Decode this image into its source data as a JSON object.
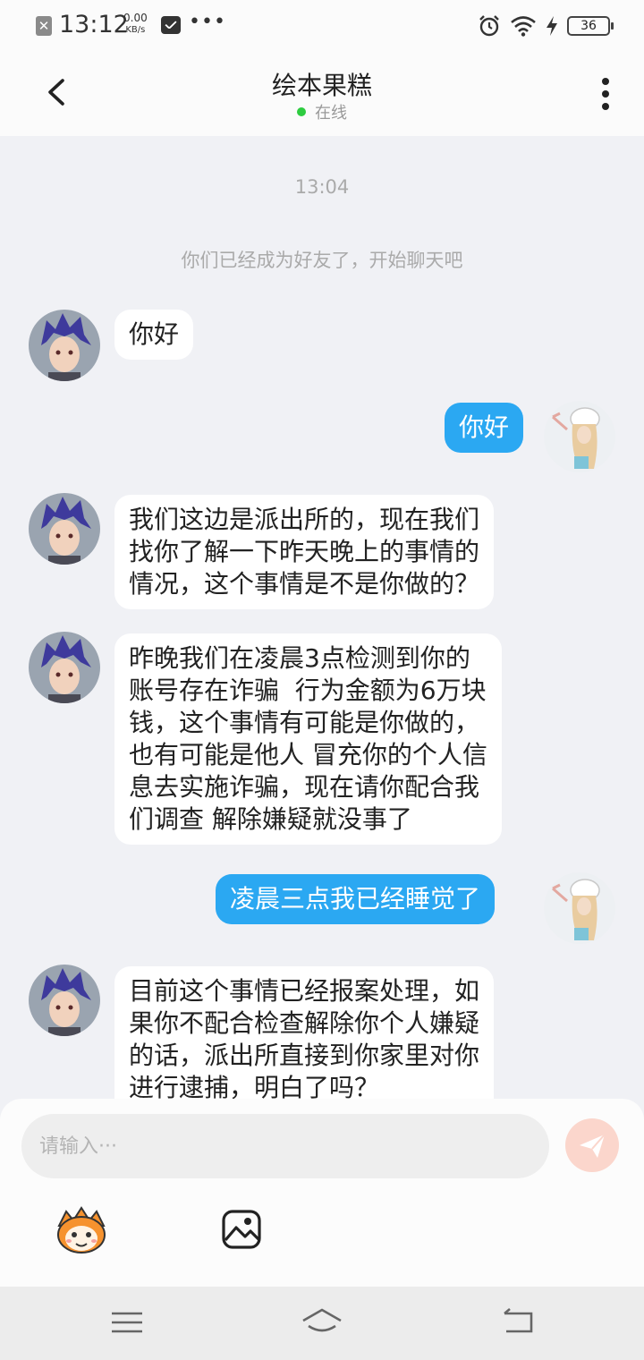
{
  "status_bar": {
    "time": "13:12",
    "speed_value": "0.00",
    "speed_unit": "KB/s",
    "battery": "36"
  },
  "header": {
    "title": "绘本果糕",
    "status": "在线",
    "status_color": "#2ecc40"
  },
  "chat": {
    "time_label": "13:04",
    "system_message": "你们已经成为好友了，开始聊天吧",
    "messages": [
      {
        "side": "incoming",
        "text": "你好"
      },
      {
        "side": "outgoing",
        "text": "你好"
      },
      {
        "side": "incoming",
        "text": "我们这边是派出所的，现在我们\n找你了解一下昨天晚上的事情的\n情况，这个事情是不是你做的？"
      },
      {
        "side": "incoming",
        "text": "昨晚我们在凌晨3点检测到你的\n账号存在诈骗  行为金额为6万块\n钱，这个事情有可能是你做的，\n也有可能是他人 冒充你的个人信\n息去实施诈骗，现在请你配合我\n们调查 解除嫌疑就没事了"
      },
      {
        "side": "outgoing",
        "text": "凌晨三点我已经睡觉了"
      },
      {
        "side": "incoming",
        "text": "目前这个事情已经报案处理，如\n果你不配合检查解除你个人嫌疑\n的话，派出所直接到你家里对你\n进行逮捕，明白了吗？"
      }
    ],
    "outgoing_bubble_color": "#2ba8f2"
  },
  "input": {
    "placeholder": "请输入···",
    "value": ""
  },
  "icons": {
    "back": "chevron-left-icon",
    "more": "more-vertical-icon",
    "send": "paper-plane-icon",
    "emoji": "cartoon-face-emoji-icon",
    "image": "image-icon",
    "nav_menu": "menu-icon",
    "nav_home": "home-icon",
    "nav_back": "back-icon"
  }
}
